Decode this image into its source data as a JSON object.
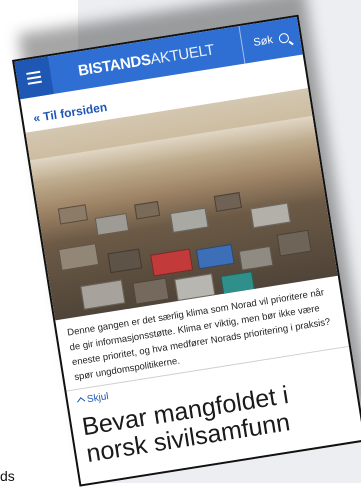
{
  "header": {
    "logo_bold": "BISTANDS",
    "logo_light": "AKTUELT",
    "search_label": "Søk",
    "brand_color": "#2f6fd3",
    "menu_icon": "hamburger-icon",
    "search_icon": "search-icon"
  },
  "nav": {
    "back_label": "Til forsiden",
    "back_icon": "double-chevron-left-icon"
  },
  "article": {
    "caption": "Denne gangen er det særlig klima som Norad vil prioritere når de gir informasjonsstøtte. Klima er viktig, men bør ikke være eneste prioritet, og hva medfører Norads prioritering i praksis? spør ungdomspolitikerne.",
    "hide_label": "Skjul",
    "hide_icon": "chevron-up-icon",
    "headline": "Bevar mangfoldet i norsk sivilsamfunn"
  },
  "background": {
    "edge_text": "ds"
  }
}
